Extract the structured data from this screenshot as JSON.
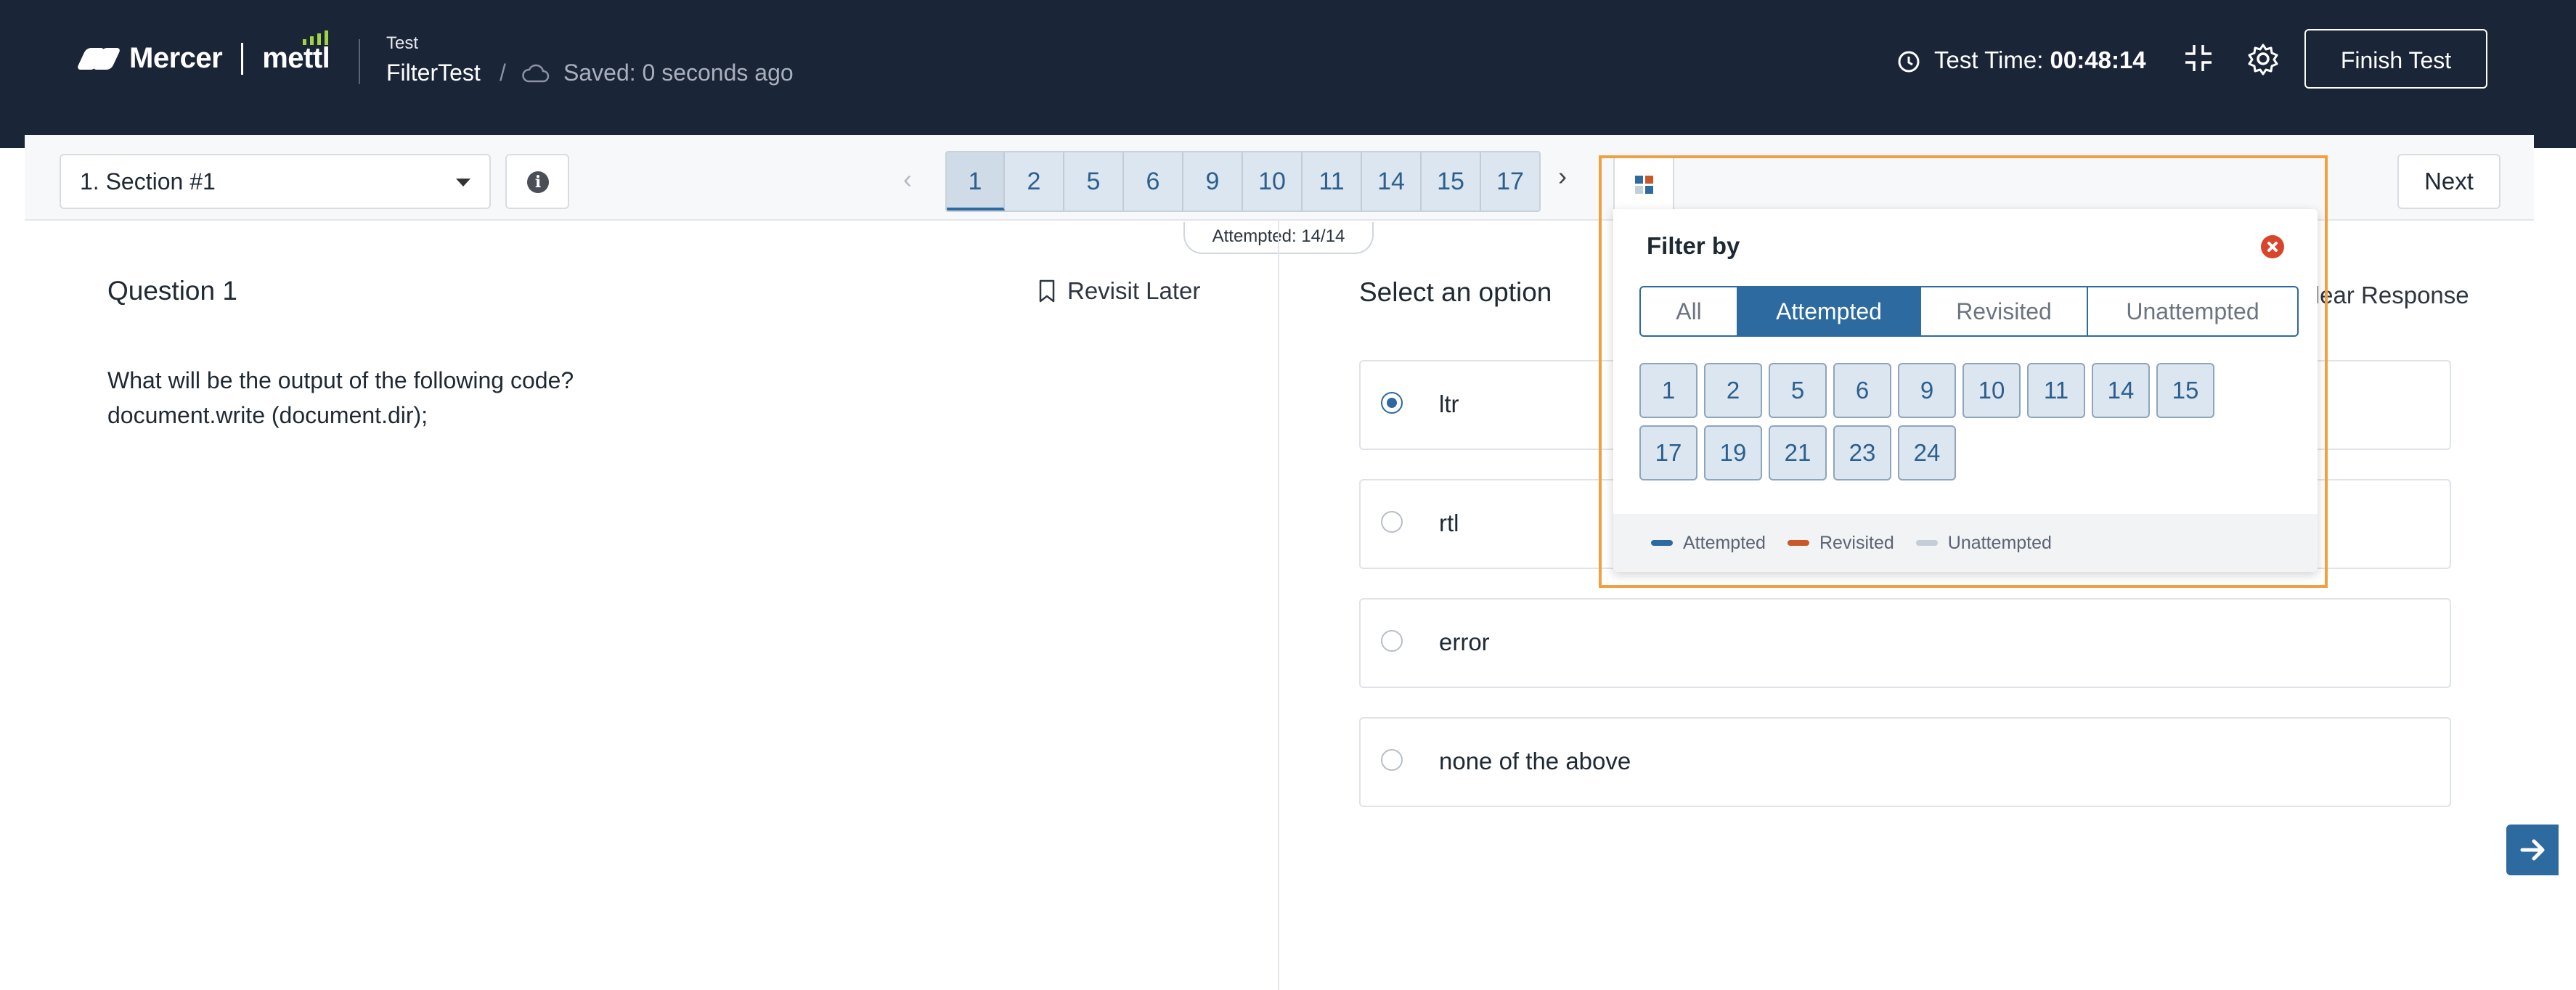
{
  "header": {
    "brand_mercer": "Mercer",
    "brand_mettl": "mettl",
    "test_label": "Test",
    "test_name": "FilterTest",
    "separator": "/",
    "saved_status": "Saved: 0 seconds ago",
    "time_label": "Test Time: ",
    "time_value": "00:48:14",
    "finish_label": "Finish Test"
  },
  "toolbar": {
    "section_value": "1. Section #1",
    "question_nav": [
      "1",
      "2",
      "5",
      "6",
      "9",
      "10",
      "11",
      "14",
      "15",
      "17"
    ],
    "active_question": "1",
    "attempted_badge": "Attempted: 14/14",
    "next_label": "Next"
  },
  "question": {
    "title": "Question 1",
    "revisit_label": "Revisit Later",
    "text_line1": "What will be the output of the following code?",
    "text_line2": "document.write (document.dir);"
  },
  "answers": {
    "heading": "Select an option",
    "clear_label": "Clear Response",
    "options": [
      {
        "label": "ltr",
        "selected": true
      },
      {
        "label": "rtl",
        "selected": false
      },
      {
        "label": "error",
        "selected": false
      },
      {
        "label": "none of the above",
        "selected": false
      }
    ]
  },
  "filter_popup": {
    "title": "Filter by",
    "tabs": [
      "All",
      "Attempted",
      "Revisited",
      "Unattempted"
    ],
    "active_tab": "Attempted",
    "numbers": [
      "1",
      "2",
      "5",
      "6",
      "9",
      "10",
      "11",
      "14",
      "15",
      "17",
      "19",
      "21",
      "23",
      "24"
    ],
    "legend": [
      {
        "label": "Attempted",
        "color": "#2c6aa0"
      },
      {
        "label": "Revisited",
        "color": "#c8582a"
      },
      {
        "label": "Unattempted",
        "color": "#c4ced8"
      }
    ]
  },
  "colors": {
    "header_bg": "#1b2538",
    "accent": "#2c6aa0",
    "highlight": "#f0a040"
  }
}
